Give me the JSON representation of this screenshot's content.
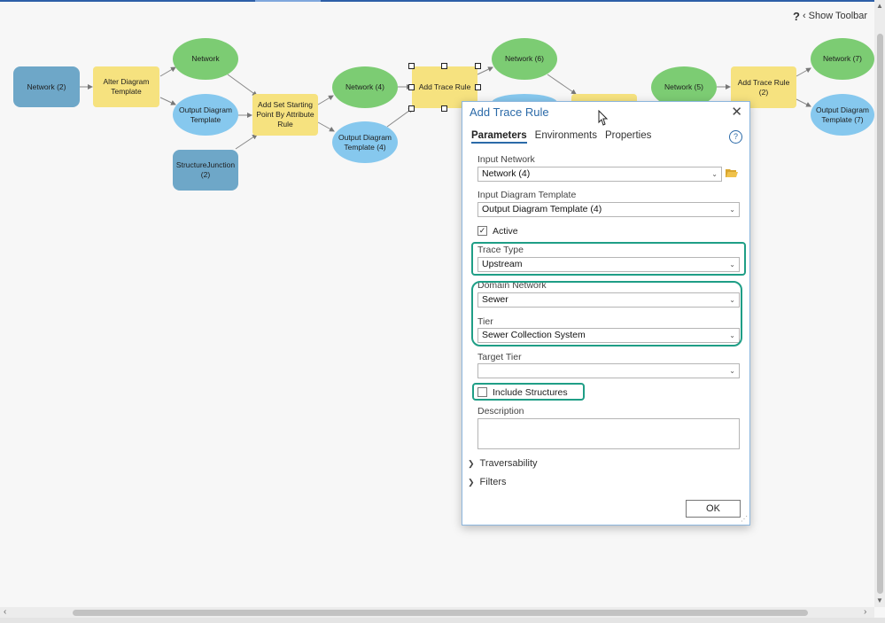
{
  "toolbar": {
    "help_glyph": "?",
    "chevron": "‹",
    "show_toolbar_label": "Show Toolbar"
  },
  "model": {
    "nodes": {
      "network_2": "Network (2)",
      "alter_template": "Alter Diagram Template",
      "network": "Network",
      "output_template": "Output Diagram Template",
      "structure_junction": "StructureJunction (2)",
      "add_set_starting": "Add Set Starting Point By Attribute Rule",
      "network_4": "Network (4)",
      "output_template_4": "Output Diagram Template (4)",
      "add_trace_rule": "Add Trace Rule",
      "network_6": "Network (6)",
      "network_5": "Network (5)",
      "add_trace_rule_2": "Add Trace Rule (2)",
      "network_7": "Network (7)",
      "output_template_7": "Output Diagram Template (7)"
    },
    "colors": {
      "data": "#6ea7c8",
      "tool": "#f6e27f",
      "output_network": "#7ccc73",
      "output_template": "#86c8ee",
      "highlight": "#1f9e86"
    }
  },
  "dialog": {
    "title": "Add Trace Rule",
    "tabs": [
      "Parameters",
      "Environments",
      "Properties"
    ],
    "input_network": {
      "label": "Input Network",
      "value": "Network (4)"
    },
    "input_template": {
      "label": "Input Diagram Template",
      "value": "Output Diagram Template (4)"
    },
    "active": {
      "label": "Active",
      "checked": true,
      "mark": "✓"
    },
    "trace_type": {
      "label": "Trace Type",
      "value": "Upstream"
    },
    "domain_network": {
      "label": "Domain Network",
      "value": "Sewer"
    },
    "tier": {
      "label": "Tier",
      "value": "Sewer Collection System"
    },
    "target_tier": {
      "label": "Target Tier",
      "value": ""
    },
    "include_structures": {
      "label": "Include Structures",
      "checked": false
    },
    "description": {
      "label": "Description",
      "value": ""
    },
    "sections": [
      "Traversability",
      "Filters"
    ],
    "ok_label": "OK"
  }
}
